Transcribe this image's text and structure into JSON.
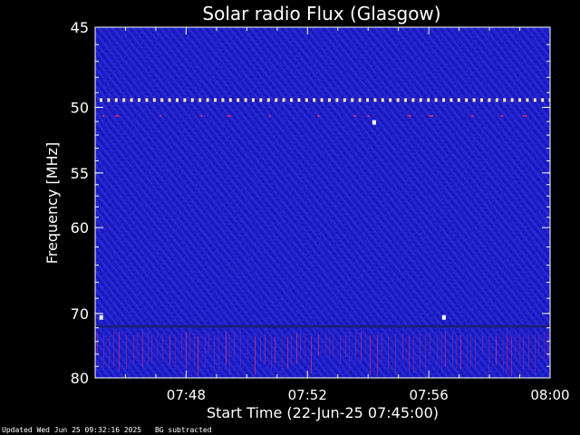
{
  "chart_data": {
    "type": "heatmap",
    "title": "Solar radio Flux (Glasgow)",
    "xlabel": "Start Time (22-Jun-25 07:45:00)",
    "ylabel": "Frequency [MHz]",
    "x_ticks": [
      "07:48",
      "07:52",
      "07:56",
      "08:00"
    ],
    "x_tick_minutes": [
      3,
      7,
      11,
      15
    ],
    "xlim_minutes": [
      0,
      15
    ],
    "y_ticks": [
      45,
      50,
      55,
      60,
      70,
      80
    ],
    "ylim": [
      45,
      80
    ],
    "y_scale": "reciprocal",
    "background_color": "#1a1ac8",
    "persistent_interference": [
      {
        "frequency": 49.5,
        "color": "#ffe8a0"
      },
      {
        "frequency": 50.6,
        "color": "#e03060"
      },
      {
        "frequency": 71.8,
        "color": "#1e1e7a"
      }
    ],
    "bright_spots": [
      {
        "time_minute": 0.2,
        "frequency": 70.6
      },
      {
        "time_minute": 9.2,
        "frequency": 51.1
      },
      {
        "time_minute": 11.5,
        "frequency": 70.6
      }
    ],
    "grid": false
  },
  "footer": {
    "updated": "Updated Wed Jun 25 09:32:16 2025",
    "note": "BG subtracted"
  }
}
